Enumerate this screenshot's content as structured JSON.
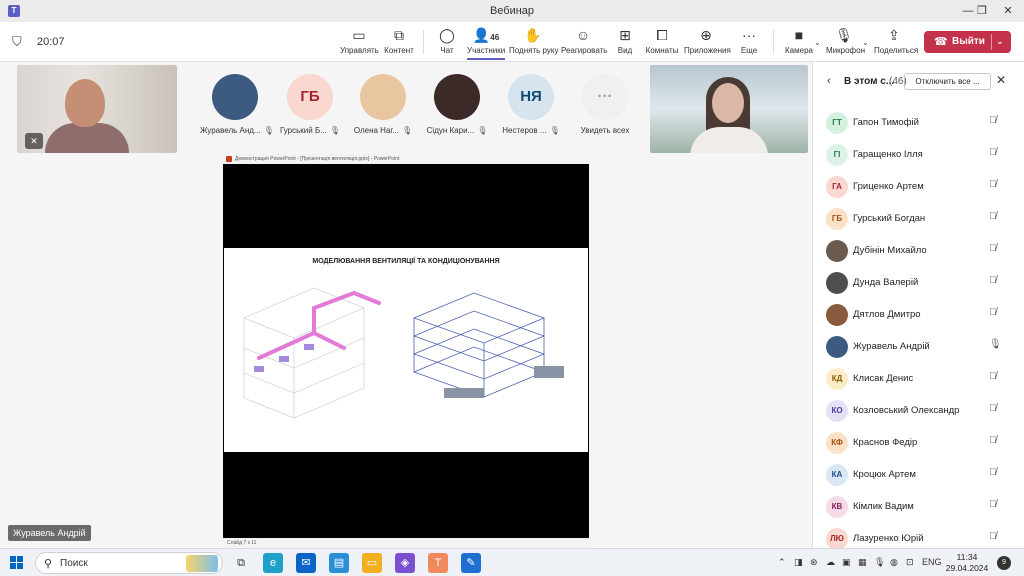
{
  "window": {
    "title": "Вебинар",
    "minimize": "—",
    "maximize": "❐",
    "close": "✕"
  },
  "meeting": {
    "timer": "20:07"
  },
  "toolbar": {
    "manage": "Управлять",
    "content": "Контент",
    "chat": "Чат",
    "participants": "Участники",
    "participants_count": "46",
    "raise_hand": "Поднять руку",
    "react": "Реагировать",
    "view": "Вид",
    "rooms": "Комнаты",
    "apps": "Приложения",
    "more": "Еще",
    "camera": "Камера",
    "mic": "Микрофон",
    "share": "Поделиться",
    "leave": "Выйти"
  },
  "stage": {
    "avatars": [
      {
        "initials": "",
        "name": "Журавель Анд...",
        "bg": "#3d5a80"
      },
      {
        "initials": "ГБ",
        "name": "Гурський Б...",
        "bg": "#f9d8d0",
        "fg": "#a4262c"
      },
      {
        "initials": "",
        "name": "Олена Наг...",
        "bg": "#e8c6a0"
      },
      {
        "initials": "",
        "name": "Сідун Кари...",
        "bg": "#3b2a28"
      },
      {
        "initials": "НЯ",
        "name": "Нестеров ...",
        "bg": "#d6e4f0",
        "fg": "#0f4a6e"
      },
      {
        "initials": "···",
        "name": "Увидеть всех",
        "bg": "#f0f0f0",
        "fg": "#999999"
      }
    ],
    "slide_window_title": "Демонстрация PowerPoint - [Презентація вентиляція.pptx] - PowerPoint",
    "slide_title": "МОДЕЛЮВАННЯ ВЕНТИЛЯЦІЇ ТА КОНДИЦІОНУВАННЯ",
    "slide_status": "Слайд 7 з 11",
    "presenter_name": "Журавель Андрій"
  },
  "panel": {
    "title": "В этом с...",
    "count": "(46)",
    "mute_all": "Отключить все ...",
    "participants": [
      {
        "initials": "ГТ",
        "name": "Гапон Тимофій",
        "bg": "#d6f0e0",
        "fg": "#1a7a3e",
        "mic": "off"
      },
      {
        "initials": "ГІ",
        "name": "Гаращенко Ілля",
        "bg": "#dcf2e6",
        "fg": "#237b4b",
        "mic": "off"
      },
      {
        "initials": "ГА",
        "name": "Гриценко Артем",
        "bg": "#f9d8d0",
        "fg": "#a4262c",
        "mic": "off"
      },
      {
        "initials": "ГБ",
        "name": "Гурський Богдан",
        "bg": "#fde0c8",
        "fg": "#a55012",
        "mic": "off"
      },
      {
        "initials": "",
        "name": "Дубінін Михайло",
        "bg": "#6b5a4e",
        "fg": "#ffffff",
        "mic": "off",
        "photo": true
      },
      {
        "initials": "",
        "name": "Дунда Валерій",
        "bg": "#4e4e4e",
        "fg": "#ffffff",
        "mic": "off",
        "photo": true
      },
      {
        "initials": "",
        "name": "Дятлов Дмитро",
        "bg": "#8a5a3c",
        "fg": "#ffffff",
        "mic": "off",
        "photo": true
      },
      {
        "initials": "",
        "name": "Журавель Андрій",
        "bg": "#3d5a80",
        "fg": "#ffffff",
        "mic": "on",
        "photo": true
      },
      {
        "initials": "КД",
        "name": "Клисак Денис",
        "bg": "#fdecc8",
        "fg": "#8a5a00",
        "mic": "off"
      },
      {
        "initials": "КО",
        "name": "Козловський Олександр",
        "bg": "#e3e1f5",
        "fg": "#4b3f9e",
        "mic": "off"
      },
      {
        "initials": "КФ",
        "name": "Краснов Федір",
        "bg": "#fde0c8",
        "fg": "#a55012",
        "mic": "off"
      },
      {
        "initials": "КА",
        "name": "Кроцюк Артем",
        "bg": "#dbe7f5",
        "fg": "#1f4e8c",
        "mic": "off"
      },
      {
        "initials": "КВ",
        "name": "Кімлик Вадим",
        "bg": "#f5dbe7",
        "fg": "#8c1f5a",
        "mic": "off"
      },
      {
        "initials": "ЛЮ",
        "name": "Лазуренко Юрій",
        "bg": "#f9d8d0",
        "fg": "#a4262c",
        "mic": "off"
      }
    ]
  },
  "taskbar": {
    "search": "Поиск",
    "lang": "ENG",
    "time": "11:34",
    "date": "29.04.2024",
    "notifications": "9"
  }
}
